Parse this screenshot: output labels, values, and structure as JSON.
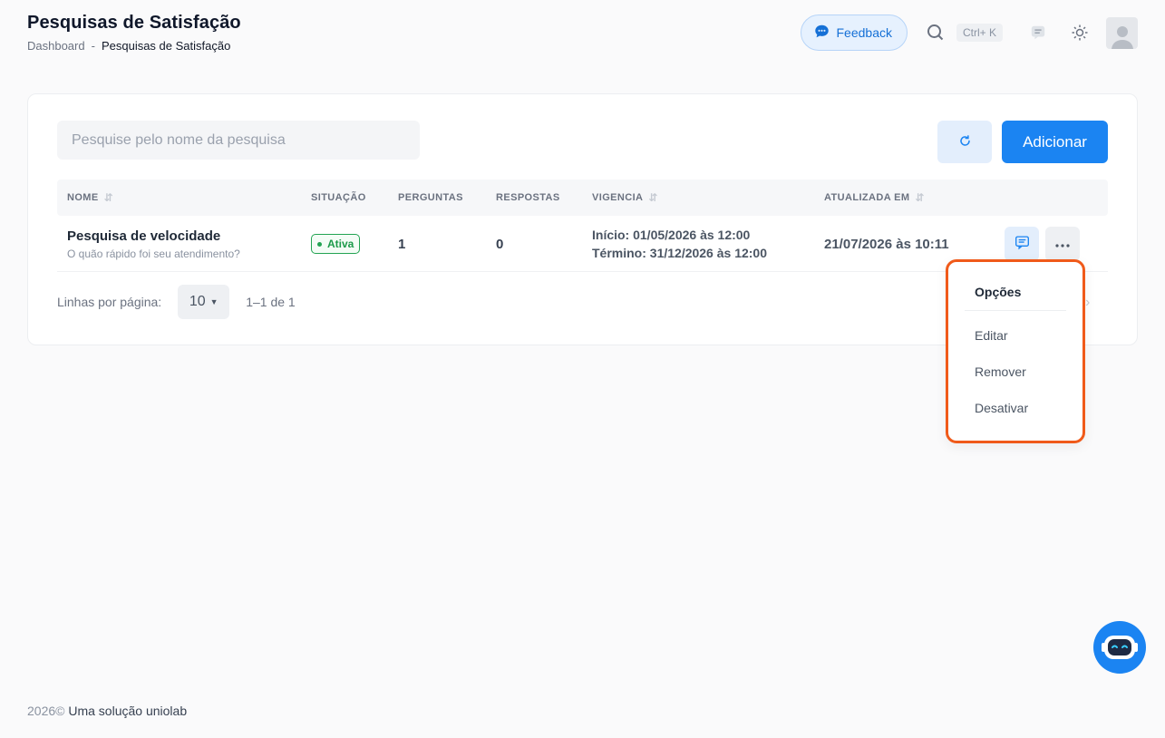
{
  "header": {
    "title": "Pesquisas de Satisfação",
    "breadcrumb": {
      "root": "Dashboard",
      "separator": "-",
      "current": "Pesquisas de Satisfação"
    }
  },
  "topbar": {
    "feedback_label": "Feedback",
    "shortcut": "Ctrl+ K"
  },
  "toolbar": {
    "search_placeholder": "Pesquise pelo nome da pesquisa",
    "add_label": "Adicionar"
  },
  "table": {
    "columns": [
      "NOME",
      "SITUAÇÃO",
      "PERGUNTAS",
      "RESPOSTAS",
      "VIGENCIA",
      "ATUALIZADA EM"
    ],
    "rows": [
      {
        "name": "Pesquisa de velocidade",
        "description": "O quão rápido foi seu atendimento?",
        "status": "Ativa",
        "questions": "1",
        "responses": "0",
        "start": "Início: 01/05/2026 às 12:00",
        "end": "Término: 31/12/2026 às 12:00",
        "updated": "21/07/2026 às 10:11"
      }
    ]
  },
  "pagination": {
    "rows_label": "Linhas por página:",
    "rows_value": "10",
    "range": "1–1 de 1"
  },
  "menu": {
    "title": "Opções",
    "items": [
      "Editar",
      "Remover",
      "Desativar"
    ]
  },
  "footer": {
    "year": "2026©",
    "text": " Uma solução uniolab"
  },
  "colors": {
    "primary": "#1b84f2",
    "active": "#22a352",
    "highlight": "#f05a1a"
  }
}
